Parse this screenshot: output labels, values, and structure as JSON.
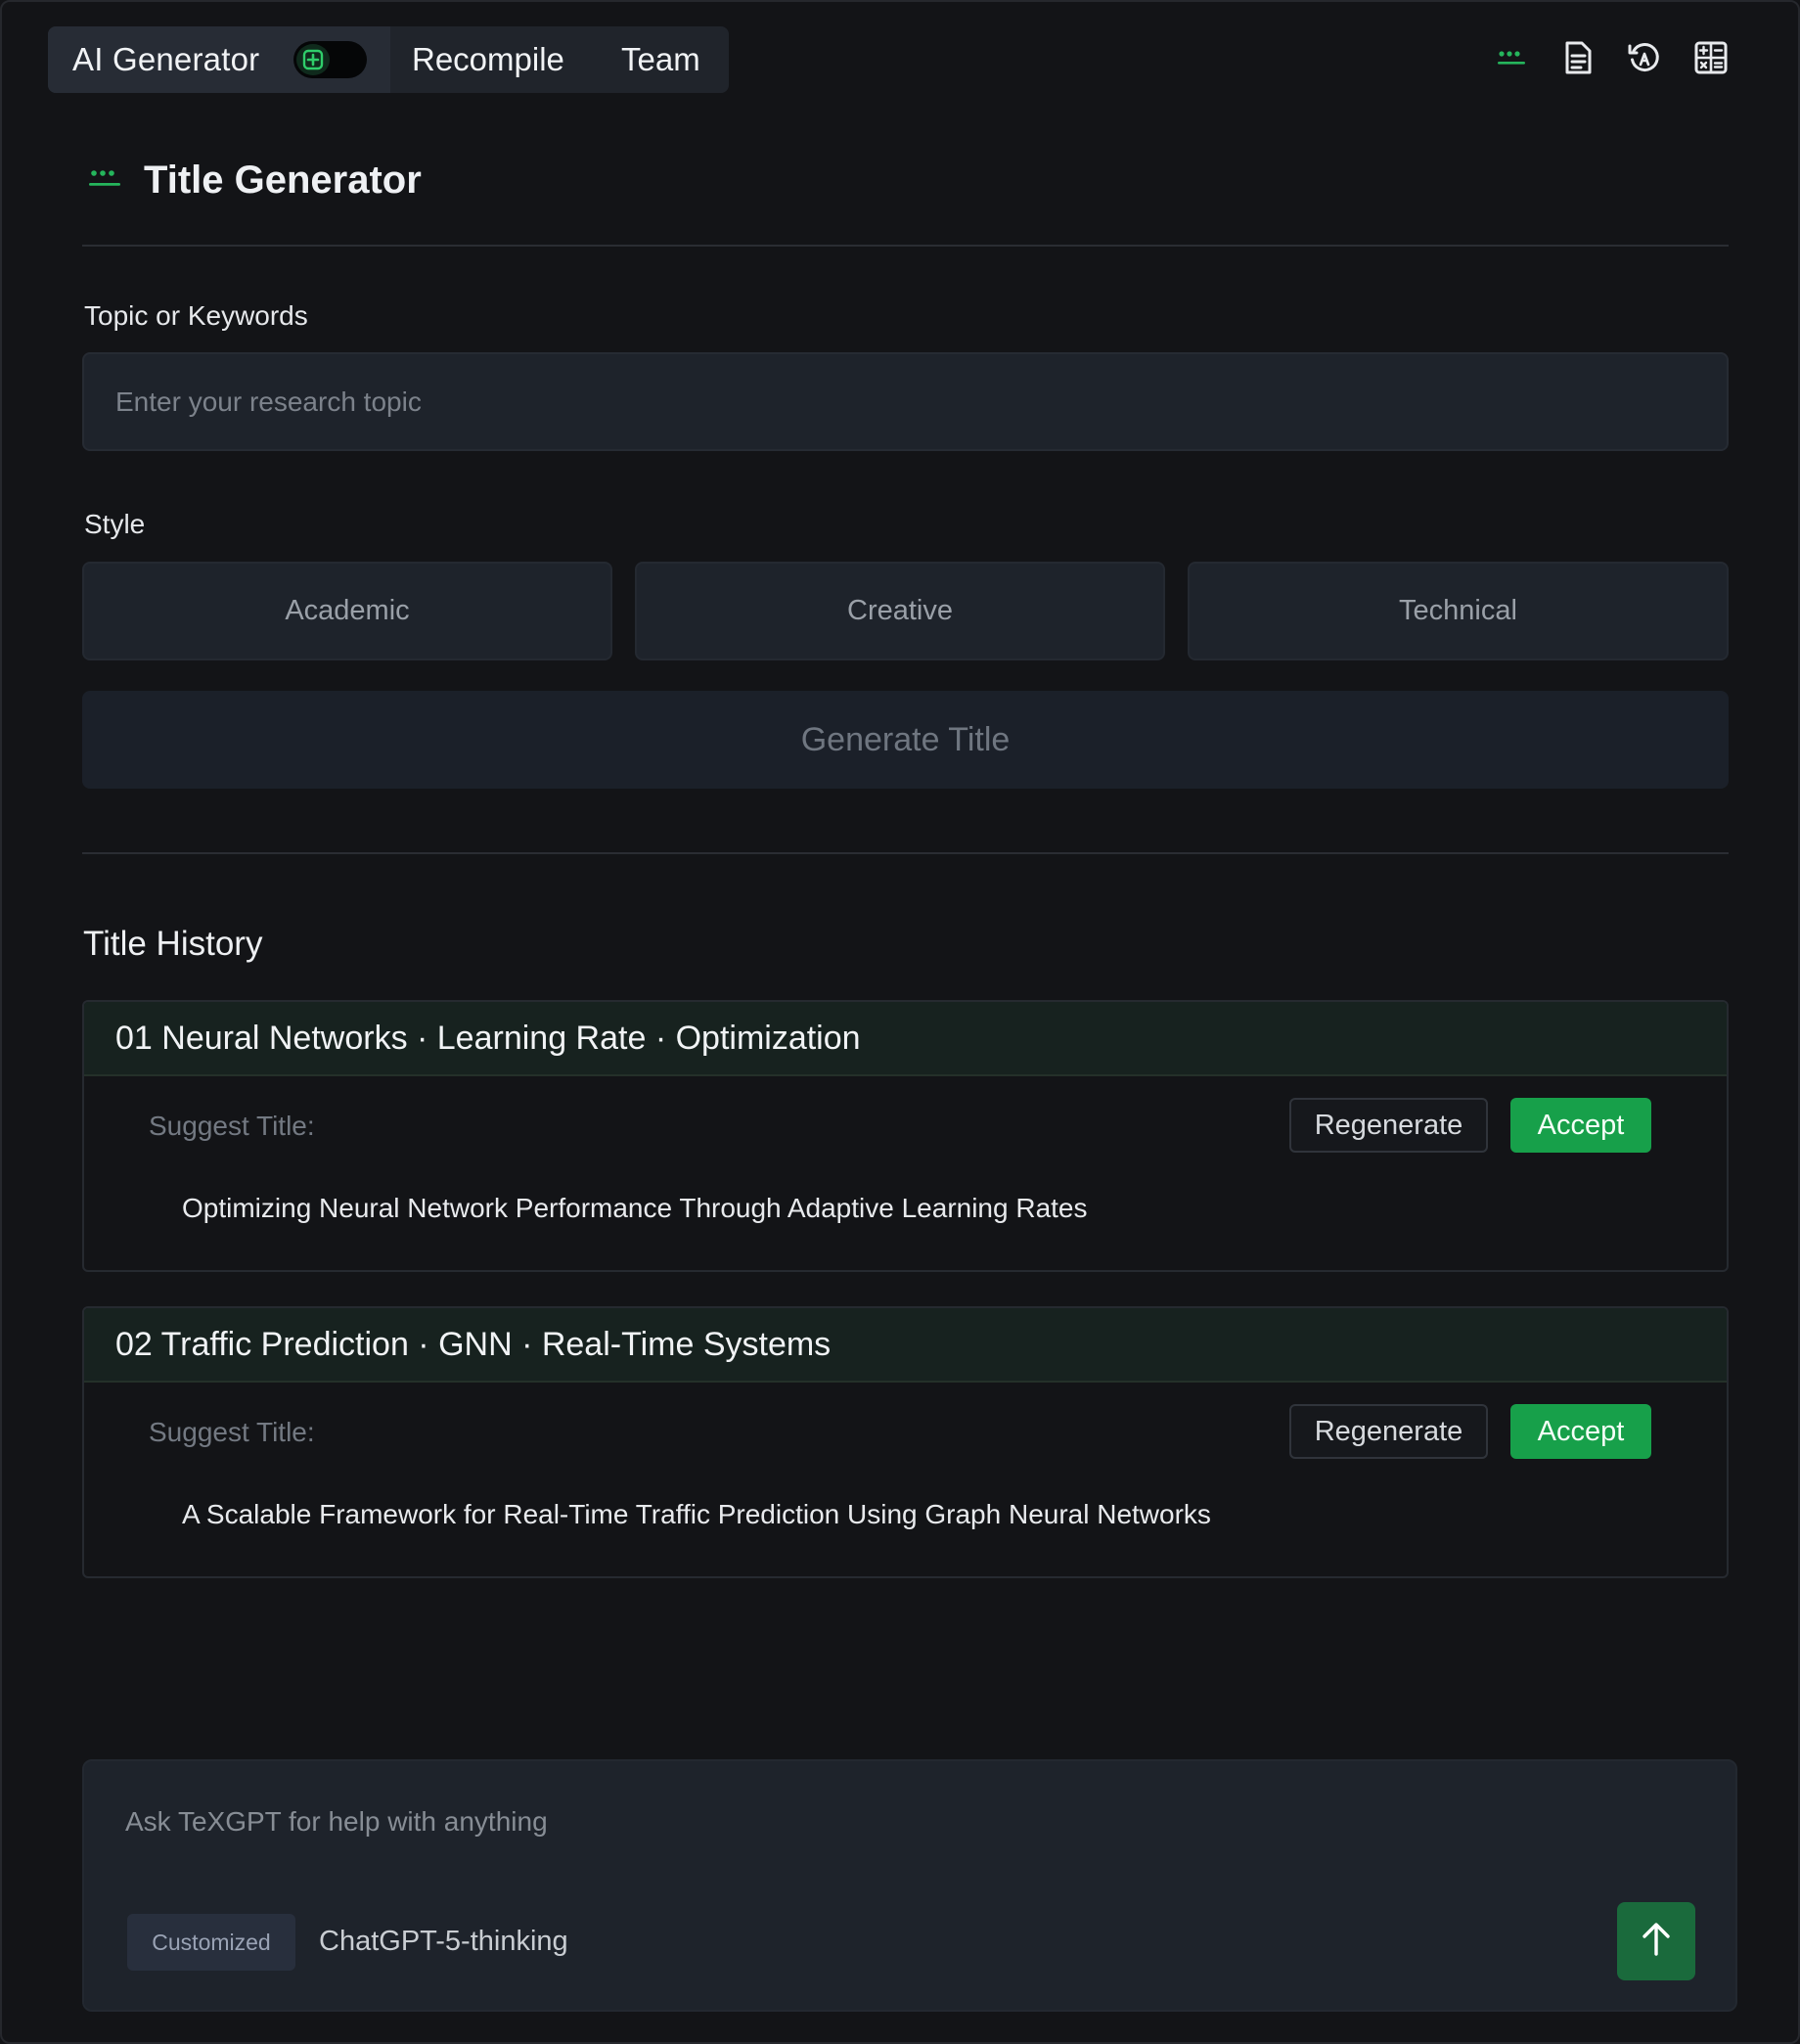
{
  "topbar": {
    "tabs": [
      {
        "label": "AI Generator"
      },
      {
        "label": "Recompile"
      },
      {
        "label": "Team"
      }
    ],
    "toggle_icon": "plus-square-icon",
    "icons": [
      "dots-icon",
      "document-icon",
      "history-icon",
      "calculator-icon"
    ]
  },
  "panel": {
    "title": "Title Generator",
    "title_icon": "dots-icon",
    "topic_label": "Topic or Keywords",
    "topic_placeholder": "Enter your research topic",
    "topic_value": "",
    "style_label": "Style",
    "styles": [
      {
        "label": "Academic"
      },
      {
        "label": "Creative"
      },
      {
        "label": "Technical"
      }
    ],
    "generate_label": "Generate Title"
  },
  "history": {
    "title": "Title History",
    "items": [
      {
        "heading": "01 Neural Networks · Learning Rate · Optimization",
        "suggest_label": "Suggest Title:",
        "regenerate_label": "Regenerate",
        "accept_label": "Accept",
        "suggestion": "Optimizing Neural Network Performance Through Adaptive Learning Rates"
      },
      {
        "heading": "02 Traffic Prediction · GNN · Real-Time Systems",
        "suggest_label": "Suggest Title:",
        "regenerate_label": "Regenerate",
        "accept_label": "Accept",
        "suggestion": "A Scalable Framework for Real-Time Traffic Prediction Using Graph Neural Networks"
      }
    ]
  },
  "chat": {
    "placeholder": "Ask TeXGPT for help with anything",
    "badge": "Customized",
    "model": "ChatGPT-5-thinking",
    "send_icon": "arrow-up-icon"
  },
  "colors": {
    "background": "#131417",
    "accent": "#17a04a",
    "surface": "#1e232b"
  }
}
